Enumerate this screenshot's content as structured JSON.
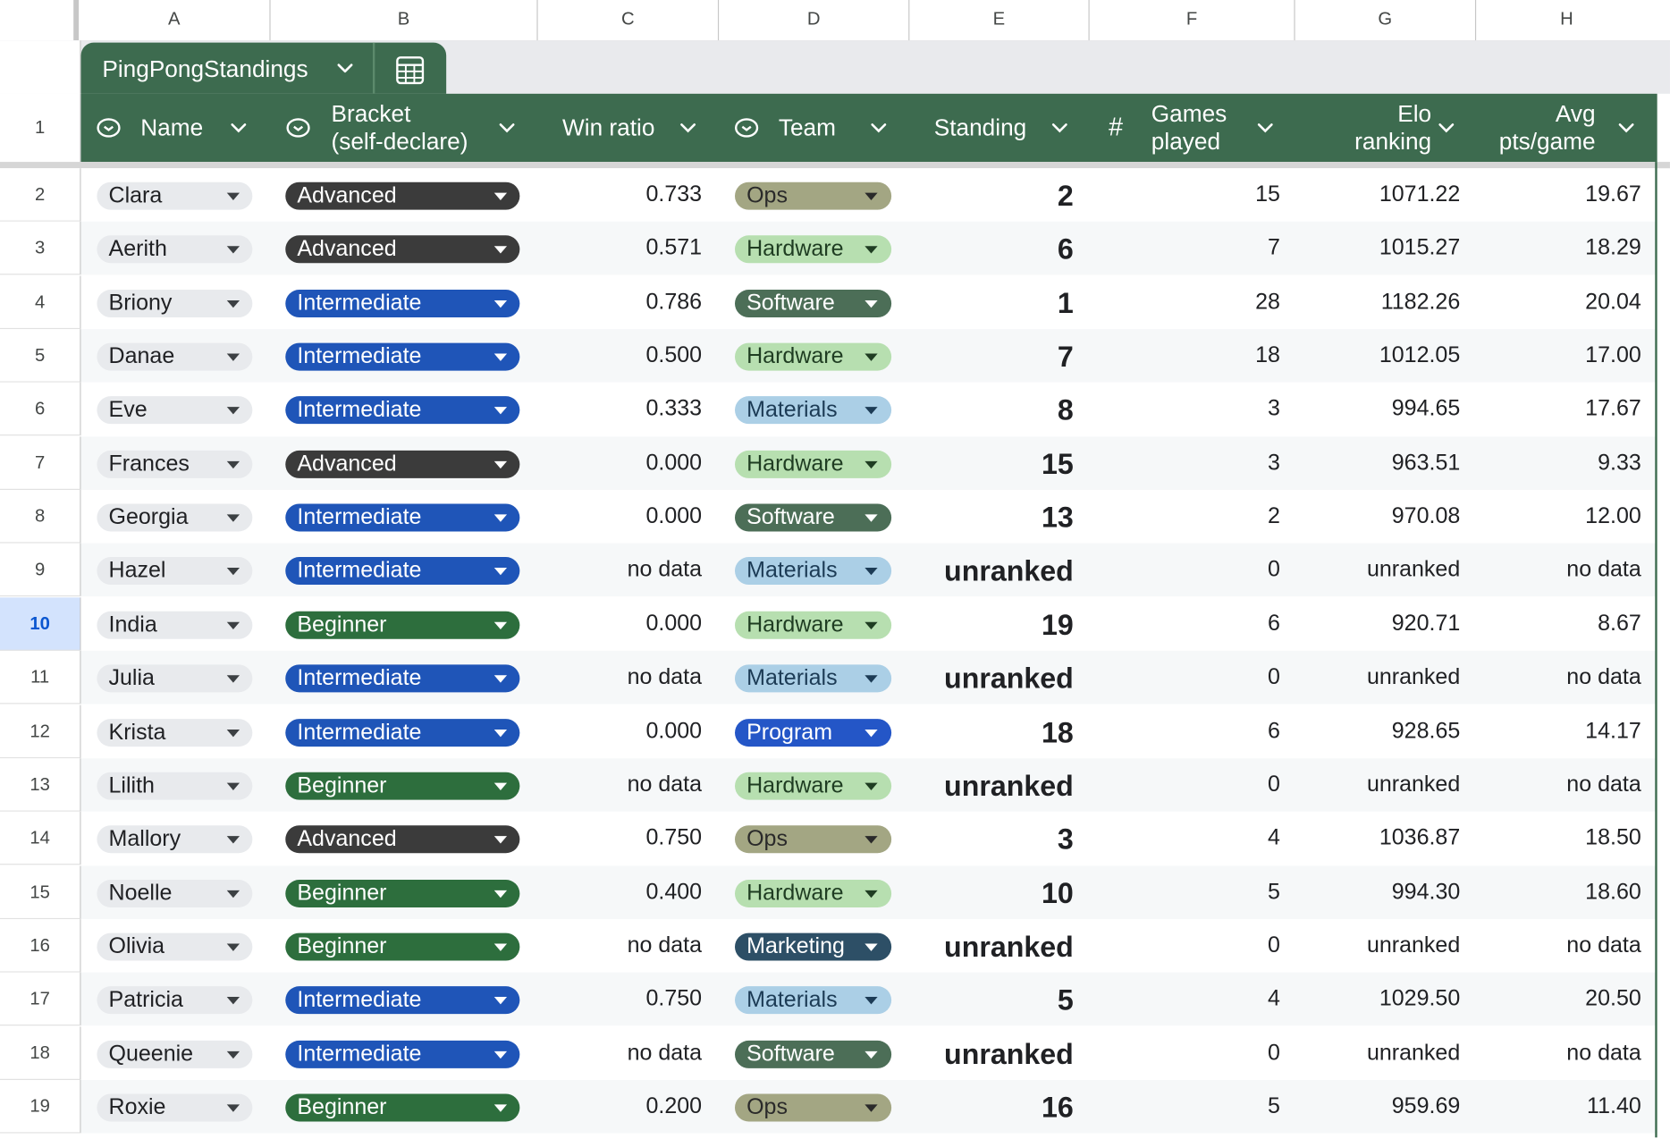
{
  "columns": [
    "A",
    "B",
    "C",
    "D",
    "E",
    "F",
    "G",
    "H"
  ],
  "table_tab": {
    "name": "PingPongStandings"
  },
  "header_row_number": "1",
  "headers": {
    "name": "Name",
    "bracket": [
      "Bracket",
      "(self-declare)"
    ],
    "win_ratio": "Win ratio",
    "team": "Team",
    "standing": "Standing",
    "games_played": [
      "Games",
      "played"
    ],
    "elo": [
      "Elo",
      "ranking"
    ],
    "avg": [
      "Avg",
      "pts/game"
    ]
  },
  "chip_colors": {
    "Advanced": {
      "bg": "#3b3b3b",
      "fg": "#ffffff"
    },
    "Intermediate": {
      "bg": "#1f55b8",
      "fg": "#ffffff"
    },
    "Beginner": {
      "bg": "#2d6e3d",
      "fg": "#ffffff"
    },
    "Ops": {
      "bg": "#a3a683",
      "fg": "#2a2a2a"
    },
    "Hardware": {
      "bg": "#b7dfb0",
      "fg": "#1f3d22"
    },
    "Software": {
      "bg": "#4c6e57",
      "fg": "#ffffff"
    },
    "Materials": {
      "bg": "#abcfe6",
      "fg": "#1c3b55"
    },
    "Program": {
      "bg": "#2456c7",
      "fg": "#ffffff"
    },
    "Marketing": {
      "bg": "#2d4f66",
      "fg": "#ffffff"
    }
  },
  "selected_row": "10",
  "rows": [
    {
      "row": "2",
      "name": "Clara",
      "bracket": "Advanced",
      "win_ratio": "0.733",
      "team": "Ops",
      "standing": "2",
      "games": "15",
      "elo": "1071.22",
      "avg": "19.67"
    },
    {
      "row": "3",
      "name": "Aerith",
      "bracket": "Advanced",
      "win_ratio": "0.571",
      "team": "Hardware",
      "standing": "6",
      "games": "7",
      "elo": "1015.27",
      "avg": "18.29"
    },
    {
      "row": "4",
      "name": "Briony",
      "bracket": "Intermediate",
      "win_ratio": "0.786",
      "team": "Software",
      "standing": "1",
      "games": "28",
      "elo": "1182.26",
      "avg": "20.04"
    },
    {
      "row": "5",
      "name": "Danae",
      "bracket": "Intermediate",
      "win_ratio": "0.500",
      "team": "Hardware",
      "standing": "7",
      "games": "18",
      "elo": "1012.05",
      "avg": "17.00"
    },
    {
      "row": "6",
      "name": "Eve",
      "bracket": "Intermediate",
      "win_ratio": "0.333",
      "team": "Materials",
      "standing": "8",
      "games": "3",
      "elo": "994.65",
      "avg": "17.67"
    },
    {
      "row": "7",
      "name": "Frances",
      "bracket": "Advanced",
      "win_ratio": "0.000",
      "team": "Hardware",
      "standing": "15",
      "games": "3",
      "elo": "963.51",
      "avg": "9.33"
    },
    {
      "row": "8",
      "name": "Georgia",
      "bracket": "Intermediate",
      "win_ratio": "0.000",
      "team": "Software",
      "standing": "13",
      "games": "2",
      "elo": "970.08",
      "avg": "12.00"
    },
    {
      "row": "9",
      "name": "Hazel",
      "bracket": "Intermediate",
      "win_ratio": "no data",
      "team": "Materials",
      "standing": "unranked",
      "games": "0",
      "elo": "unranked",
      "avg": "no data"
    },
    {
      "row": "10",
      "name": "India",
      "bracket": "Beginner",
      "win_ratio": "0.000",
      "team": "Hardware",
      "standing": "19",
      "games": "6",
      "elo": "920.71",
      "avg": "8.67"
    },
    {
      "row": "11",
      "name": "Julia",
      "bracket": "Intermediate",
      "win_ratio": "no data",
      "team": "Materials",
      "standing": "unranked",
      "games": "0",
      "elo": "unranked",
      "avg": "no data"
    },
    {
      "row": "12",
      "name": "Krista",
      "bracket": "Intermediate",
      "win_ratio": "0.000",
      "team": "Program",
      "standing": "18",
      "games": "6",
      "elo": "928.65",
      "avg": "14.17"
    },
    {
      "row": "13",
      "name": "Lilith",
      "bracket": "Beginner",
      "win_ratio": "no data",
      "team": "Hardware",
      "standing": "unranked",
      "games": "0",
      "elo": "unranked",
      "avg": "no data"
    },
    {
      "row": "14",
      "name": "Mallory",
      "bracket": "Advanced",
      "win_ratio": "0.750",
      "team": "Ops",
      "standing": "3",
      "games": "4",
      "elo": "1036.87",
      "avg": "18.50"
    },
    {
      "row": "15",
      "name": "Noelle",
      "bracket": "Beginner",
      "win_ratio": "0.400",
      "team": "Hardware",
      "standing": "10",
      "games": "5",
      "elo": "994.30",
      "avg": "18.60"
    },
    {
      "row": "16",
      "name": "Olivia",
      "bracket": "Beginner",
      "win_ratio": "no data",
      "team": "Marketing",
      "standing": "unranked",
      "games": "0",
      "elo": "unranked",
      "avg": "no data"
    },
    {
      "row": "17",
      "name": "Patricia",
      "bracket": "Intermediate",
      "win_ratio": "0.750",
      "team": "Materials",
      "standing": "5",
      "games": "4",
      "elo": "1029.50",
      "avg": "20.50"
    },
    {
      "row": "18",
      "name": "Queenie",
      "bracket": "Intermediate",
      "win_ratio": "no data",
      "team": "Software",
      "standing": "unranked",
      "games": "0",
      "elo": "unranked",
      "avg": "no data"
    },
    {
      "row": "19",
      "name": "Roxie",
      "bracket": "Beginner",
      "win_ratio": "0.200",
      "team": "Ops",
      "standing": "16",
      "games": "5",
      "elo": "959.69",
      "avg": "11.40"
    }
  ]
}
